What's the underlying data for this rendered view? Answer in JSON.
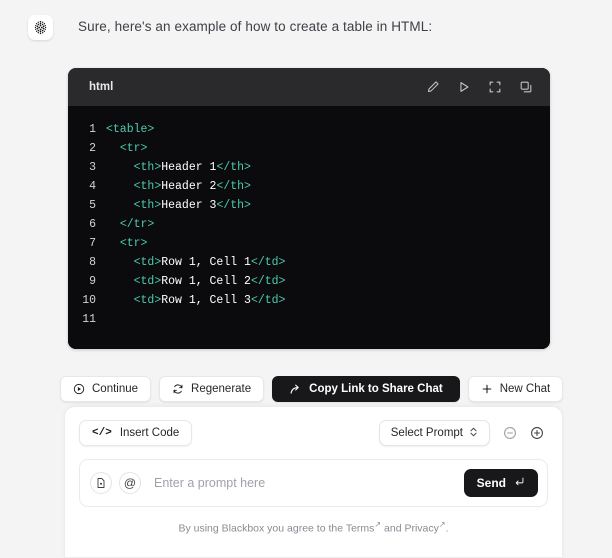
{
  "message": {
    "avatar_icon": "blackbox-dotted-logo-icon",
    "text": "Sure, here's an example of how to create a table in HTML:"
  },
  "code_block": {
    "language_label": "html",
    "actions": [
      {
        "name": "edit-code-button",
        "icon": "pencil-icon"
      },
      {
        "name": "run-code-button",
        "icon": "play-icon"
      },
      {
        "name": "fullscreen-code-button",
        "icon": "fullscreen-icon"
      },
      {
        "name": "copy-code-button",
        "icon": "copy-icon"
      }
    ],
    "lines": [
      {
        "num": "1",
        "indent": 0,
        "segments": [
          {
            "t": "tag",
            "v": "<table>"
          }
        ]
      },
      {
        "num": "2",
        "indent": 1,
        "segments": [
          {
            "t": "tag",
            "v": "<tr>"
          }
        ]
      },
      {
        "num": "3",
        "indent": 2,
        "segments": [
          {
            "t": "tag",
            "v": "<th>"
          },
          {
            "t": "txt",
            "v": "Header 1"
          },
          {
            "t": "tag",
            "v": "</th>"
          }
        ]
      },
      {
        "num": "4",
        "indent": 2,
        "segments": [
          {
            "t": "tag",
            "v": "<th>"
          },
          {
            "t": "txt",
            "v": "Header 2"
          },
          {
            "t": "tag",
            "v": "</th>"
          }
        ]
      },
      {
        "num": "5",
        "indent": 2,
        "segments": [
          {
            "t": "tag",
            "v": "<th>"
          },
          {
            "t": "txt",
            "v": "Header 3"
          },
          {
            "t": "tag",
            "v": "</th>"
          }
        ]
      },
      {
        "num": "6",
        "indent": 1,
        "segments": [
          {
            "t": "tag",
            "v": "</tr>"
          }
        ]
      },
      {
        "num": "7",
        "indent": 1,
        "segments": [
          {
            "t": "tag",
            "v": "<tr>"
          }
        ]
      },
      {
        "num": "8",
        "indent": 2,
        "segments": [
          {
            "t": "tag",
            "v": "<td>"
          },
          {
            "t": "txt",
            "v": "Row 1, Cell 1"
          },
          {
            "t": "tag",
            "v": "</td>"
          }
        ]
      },
      {
        "num": "9",
        "indent": 2,
        "segments": [
          {
            "t": "tag",
            "v": "<td>"
          },
          {
            "t": "txt",
            "v": "Row 1, Cell 2"
          },
          {
            "t": "tag",
            "v": "</td>"
          }
        ]
      },
      {
        "num": "10",
        "indent": 2,
        "segments": [
          {
            "t": "tag",
            "v": "<td>"
          },
          {
            "t": "txt",
            "v": "Row 1, Cell 3"
          },
          {
            "t": "tag",
            "v": "</td>"
          }
        ]
      },
      {
        "num": "11",
        "indent": 0,
        "segments": []
      }
    ],
    "colors": {
      "header_bg": "#2a2a2d",
      "body_bg": "#0b0b0d",
      "tag": "#4ec9ae",
      "text": "#ffffff",
      "line_number": "#d4d4d8"
    }
  },
  "actions": [
    {
      "name": "continue-button",
      "label": "Continue",
      "icon": "play-circle-icon",
      "style": "light"
    },
    {
      "name": "regenerate-button",
      "label": "Regenerate",
      "icon": "refresh-icon",
      "style": "light"
    },
    {
      "name": "copy-link-button",
      "label": "Copy Link to Share Chat",
      "icon": "share-arrow-icon",
      "style": "dark"
    },
    {
      "name": "new-chat-button",
      "label": "New Chat",
      "icon": "plus-icon",
      "style": "light"
    }
  ],
  "composer": {
    "insert_code_label": "Insert Code",
    "insert_code_icon": "code-brackets-icon",
    "select_prompt_label": "Select Prompt",
    "select_prompt_icon": "chevron-updown-icon",
    "minus_icon": "minus-circle-icon",
    "plus_icon": "plus-circle-icon",
    "attach_icon": "file-attach-icon",
    "mention_icon": "at-mention-icon",
    "prompt_placeholder": "Enter a prompt here",
    "prompt_value": "",
    "send_label": "Send",
    "send_icon": "enter-return-icon"
  },
  "footer": {
    "prefix": "By using Blackbox you agree to the ",
    "terms_label": "Terms",
    "middle": " and ",
    "privacy_label": "Privacy",
    "suffix": "."
  },
  "theme": {
    "page_bg": "#f4f4f5",
    "panel_bg": "#ffffff",
    "dark_accent": "#18181b",
    "muted_text": "#8a8a93"
  }
}
